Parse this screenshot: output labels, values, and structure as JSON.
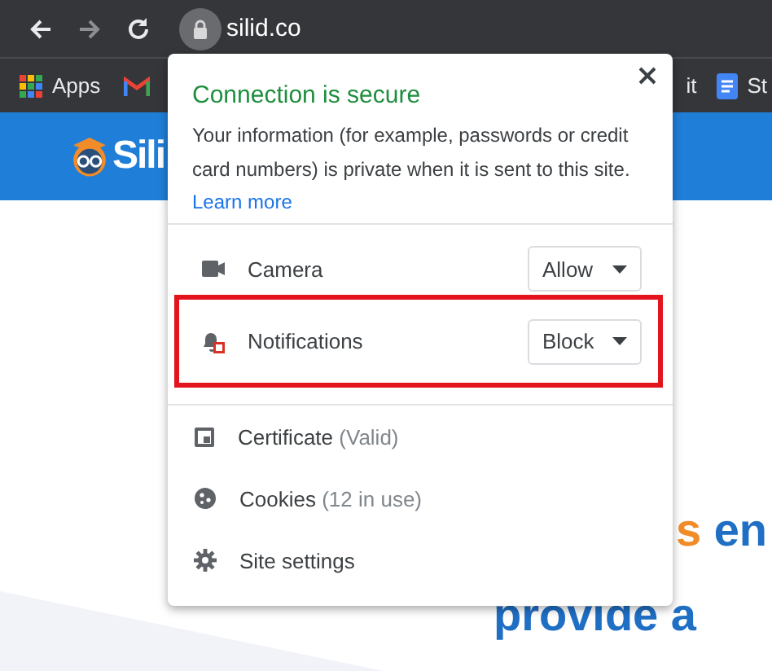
{
  "toolbar": {
    "url": "silid.co"
  },
  "bookmarks": [
    {
      "kind": "apps",
      "label": "Apps"
    },
    {
      "kind": "gmail"
    },
    {
      "kind": "plain",
      "label": "it"
    },
    {
      "kind": "doc",
      "label": "St"
    }
  ],
  "site": {
    "logo_text": "Sili",
    "headline": [
      {
        "parts": [
          {
            "text": "s",
            "accent": true
          },
          {
            "text": "en",
            "accent": false
          }
        ]
      },
      {
        "parts": [
          {
            "text": "provide a",
            "accent": false
          }
        ]
      }
    ]
  },
  "popup": {
    "title": "Connection is secure",
    "body": "Your information (for example, passwords or credit card numbers) is private when it is sent to this site.",
    "link": "Learn more",
    "permissions": [
      {
        "kind": "camera",
        "label": "Camera",
        "value": "Allow",
        "highlighted": false
      },
      {
        "kind": "notifications",
        "label": "Notifications",
        "value": "Block",
        "highlighted": true
      }
    ],
    "items": [
      {
        "kind": "certificate",
        "label": "Certificate",
        "note": "(Valid)"
      },
      {
        "kind": "cookies",
        "label": "Cookies",
        "note": "(12 in use)"
      },
      {
        "kind": "settings",
        "label": "Site settings"
      }
    ]
  }
}
